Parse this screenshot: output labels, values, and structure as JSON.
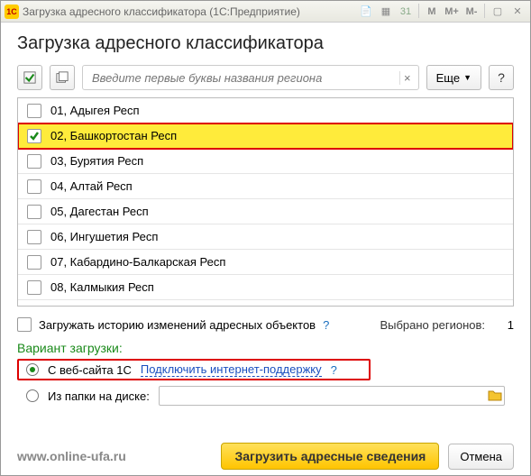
{
  "window": {
    "icon_label": "1C",
    "title": "Загрузка адресного классификатора  (1С:Предприятие)"
  },
  "page": {
    "title": "Загрузка адресного классификатора"
  },
  "search": {
    "placeholder": "Введите первые буквы названия региона"
  },
  "more_btn": "Еще",
  "regions": [
    {
      "code": "01",
      "name": "Адыгея Респ",
      "checked": false,
      "selected": false
    },
    {
      "code": "02",
      "name": "Башкортостан Респ",
      "checked": true,
      "selected": true
    },
    {
      "code": "03",
      "name": "Бурятия Респ",
      "checked": false,
      "selected": false
    },
    {
      "code": "04",
      "name": "Алтай Респ",
      "checked": false,
      "selected": false
    },
    {
      "code": "05",
      "name": "Дагестан Респ",
      "checked": false,
      "selected": false
    },
    {
      "code": "06",
      "name": "Ингушетия Респ",
      "checked": false,
      "selected": false
    },
    {
      "code": "07",
      "name": "Кабардино-Балкарская Респ",
      "checked": false,
      "selected": false
    },
    {
      "code": "08",
      "name": "Калмыкия Респ",
      "checked": false,
      "selected": false
    }
  ],
  "history_cb_label": "Загружать историю изменений адресных объектов",
  "selected_label": "Выбрано регионов:",
  "selected_count": "1",
  "variant_title": "Вариант загрузки:",
  "radio_web_label": "С веб-сайта 1С",
  "connect_link": "Подключить интернет-поддержку",
  "radio_folder_label": "Из папки на диске:",
  "load_btn": "Загрузить адресные сведения",
  "cancel_btn": "Отмена",
  "watermark": "www.online-ufa.ru"
}
